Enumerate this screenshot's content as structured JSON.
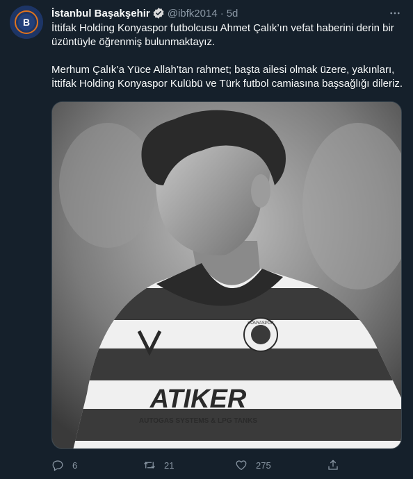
{
  "tweet": {
    "author_name": "İstanbul Başakşehir",
    "handle": "@ibfk2014",
    "separator": "·",
    "time": "5d",
    "text_line1": "İttifak Holding Konyaspor futbolcusu Ahmet Çalık’ın vefat haberini derin bir",
    "text_line2": "üzüntüyle öğrenmiş bulunmaktayız.",
    "text_line3": "Merhum Çalık’a Yüce Allah’tan rahmet; başta ailesi olmak üzere, yakınları,",
    "text_line4": "İttifak Holding Konyaspor Kulübü ve Türk futbol camiasına başsağlığı dileriz.",
    "media": {
      "description_icon": "player-photo",
      "jersey_sponsor": "ATIKER",
      "jersey_sponsor_sub": "AUTOGAS SYSTEMS & LPG TANKS",
      "badge_text": "KONYASPOR"
    },
    "stats": {
      "replies": "6",
      "retweets": "21",
      "likes": "275"
    }
  },
  "icons": {
    "verified": "verified-badge-icon",
    "more": "more-icon",
    "reply": "reply-icon",
    "retweet": "retweet-icon",
    "like": "like-icon",
    "share": "share-icon"
  },
  "colors": {
    "background": "#15202b",
    "text": "#f7f9f9",
    "secondary": "#8b98a5",
    "avatar_bg": "#1d3566"
  }
}
